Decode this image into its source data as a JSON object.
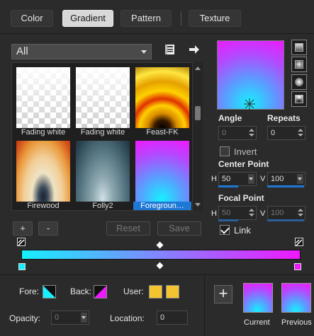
{
  "tabs": [
    {
      "label": "Color",
      "active": false
    },
    {
      "label": "Gradient",
      "active": true
    },
    {
      "label": "Pattern",
      "active": false
    },
    {
      "label": "Texture",
      "active": false
    }
  ],
  "preset_filter": {
    "value": "All"
  },
  "presets": [
    {
      "name": "Fading white",
      "selected": false
    },
    {
      "name": "Fading white",
      "selected": false
    },
    {
      "name": "Feast-FK",
      "selected": false
    },
    {
      "name": "Firewood",
      "selected": false
    },
    {
      "name": "Folly2",
      "selected": false
    },
    {
      "name": "Foregroun…",
      "selected": true
    }
  ],
  "list_buttons": {
    "add": "+",
    "remove": "-",
    "reset": "Reset",
    "save": "Save"
  },
  "angle": {
    "label": "Angle",
    "value": "0"
  },
  "repeats": {
    "label": "Repeats",
    "value": "0"
  },
  "invert": {
    "label": "Invert",
    "checked": false
  },
  "center_point": {
    "label": "Center Point",
    "h_label": "H",
    "h_value": "50",
    "v_label": "V",
    "v_value": "100"
  },
  "focal_point": {
    "label": "Focal Point",
    "h_label": "H",
    "h_value": "50",
    "v_label": "V",
    "v_value": "100"
  },
  "link": {
    "label": "Link",
    "checked": true
  },
  "gradient": {
    "start_color": "#16f0ff",
    "end_color": "#f018ff"
  },
  "stop_panel": {
    "fore_label": "Fore:",
    "back_label": "Back:",
    "user_label": "User:",
    "opacity_label": "Opacity:",
    "opacity_value": "0",
    "location_label": "Location:",
    "location_value": "0",
    "user_color": "#f4c430"
  },
  "swatches": {
    "current_label": "Current",
    "previous_label": "Previous",
    "add_label": "+"
  },
  "colors": {
    "accent": "#1e78d6",
    "cyan": "#16f0ff",
    "magenta": "#f018ff"
  }
}
